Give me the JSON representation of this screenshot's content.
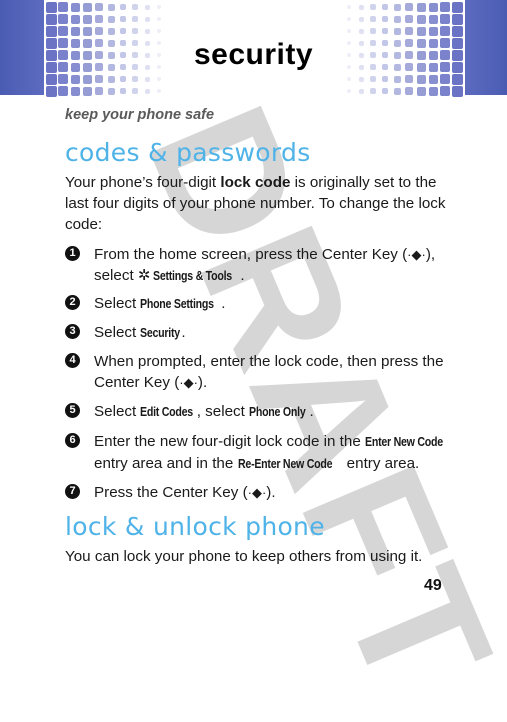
{
  "header": {
    "title": "security",
    "colors": {
      "band": "#4a5cb2",
      "square": "#6b74c4"
    }
  },
  "subtitle": "keep your phone safe",
  "watermark": "DRAFT",
  "sections": [
    {
      "heading": "codes & passwords",
      "intro": {
        "before": "Your phone’s four-digit ",
        "bold": "lock code",
        "after": " is originally set to the last four digits of your phone number. To change the lock code:"
      },
      "steps": [
        {
          "num": "1",
          "parts": [
            "From the home screen, press the Center Key (",
            "), select ",
            "Settings & Tools",
            "."
          ],
          "icon": "gear-icon"
        },
        {
          "num": "2",
          "parts": [
            "Select ",
            "Phone Settings",
            "."
          ]
        },
        {
          "num": "3",
          "parts": [
            "Select ",
            "Security",
            "."
          ]
        },
        {
          "num": "4",
          "parts": [
            "When prompted, enter the lock code, then press the Center Key (",
            ")."
          ]
        },
        {
          "num": "5",
          "parts": [
            "Select ",
            "Edit Codes",
            ", select ",
            "Phone Only",
            "."
          ]
        },
        {
          "num": "6",
          "parts": [
            "Enter the new four-digit lock code in the ",
            "Enter New Code",
            " entry area and in the ",
            "Re-Enter New Code",
            " entry area."
          ]
        },
        {
          "num": "7",
          "parts": [
            "Press the Center Key (",
            ")."
          ]
        }
      ]
    },
    {
      "heading": "lock & unlock phone",
      "body": "You can lock your phone to keep others from using it."
    }
  ],
  "icons": {
    "center_key": "·◆·",
    "gear": "✲"
  },
  "page_number": "49",
  "accent_color": "#4fb3e8"
}
